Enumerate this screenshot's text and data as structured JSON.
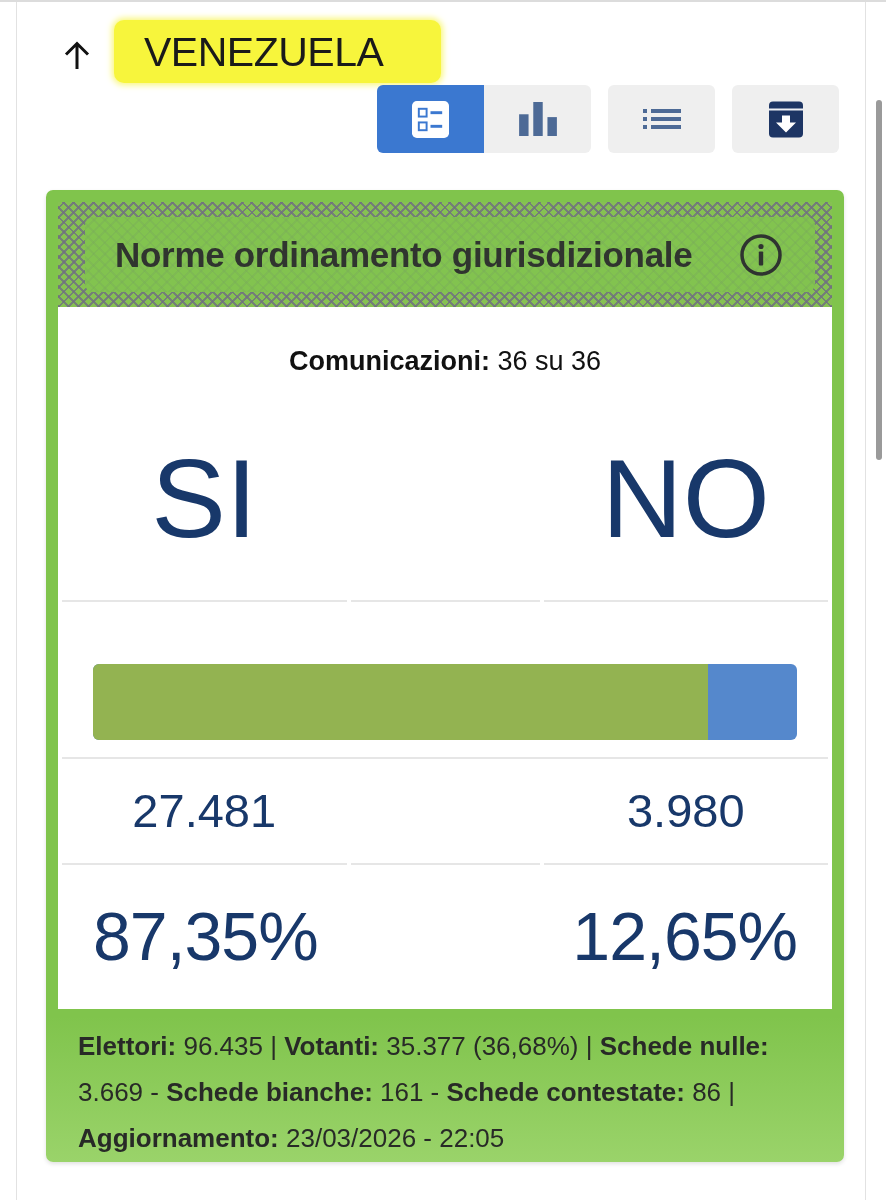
{
  "header": {
    "title": "VENEZUELA",
    "highlighted": true
  },
  "view_tabs": [
    {
      "kind": "cards",
      "selected": true
    },
    {
      "kind": "chart",
      "selected": false
    },
    {
      "kind": "list",
      "selected": false
    }
  ],
  "card": {
    "title": "Norme ordinamento giurisdizionale",
    "communications": "**Comunicazioni:** 36 su 36",
    "options": [
      {
        "label": "SI",
        "votes": "27.481",
        "percent": "87,35%"
      },
      {
        "label": "NO",
        "votes": "3.980",
        "percent": "12,65%"
      }
    ],
    "share_bar": {
      "level": 0.8735
    },
    "footer": "**Elettori:** 96.435 | **Votanti:** 35.377 (36,68%) | **Schede nulle:** 3.669 - **Schede bianche:** 161 - **Schede contestate:** 86 | **Aggiornamento:** 23/03/2026 - 22:05"
  }
}
